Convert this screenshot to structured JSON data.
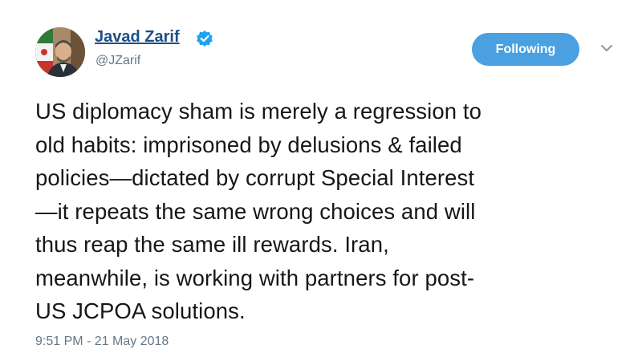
{
  "tweet": {
    "author": {
      "display_name": "Javad Zarif",
      "handle": "@JZarif",
      "verified": true
    },
    "follow_button_label": "Following",
    "text_lines": [
      "US diplomacy sham is merely a regression to",
      "old habits: imprisoned by delusions & failed",
      "policies—dictated by corrupt Special Interest",
      "—it repeats the same wrong choices and will",
      "thus reap the same ill rewards. Iran,",
      "meanwhile, is working with partners for post-",
      "US JCPOA solutions."
    ],
    "timestamp": "9:51 PM - 21 May 2018",
    "icons": {
      "verified": "verified-badge-icon",
      "menu": "chevron-down-icon"
    },
    "colors": {
      "name": "#1d4f86",
      "button": "#4aa0e0",
      "muted": "#657786",
      "text": "#14171a"
    }
  }
}
